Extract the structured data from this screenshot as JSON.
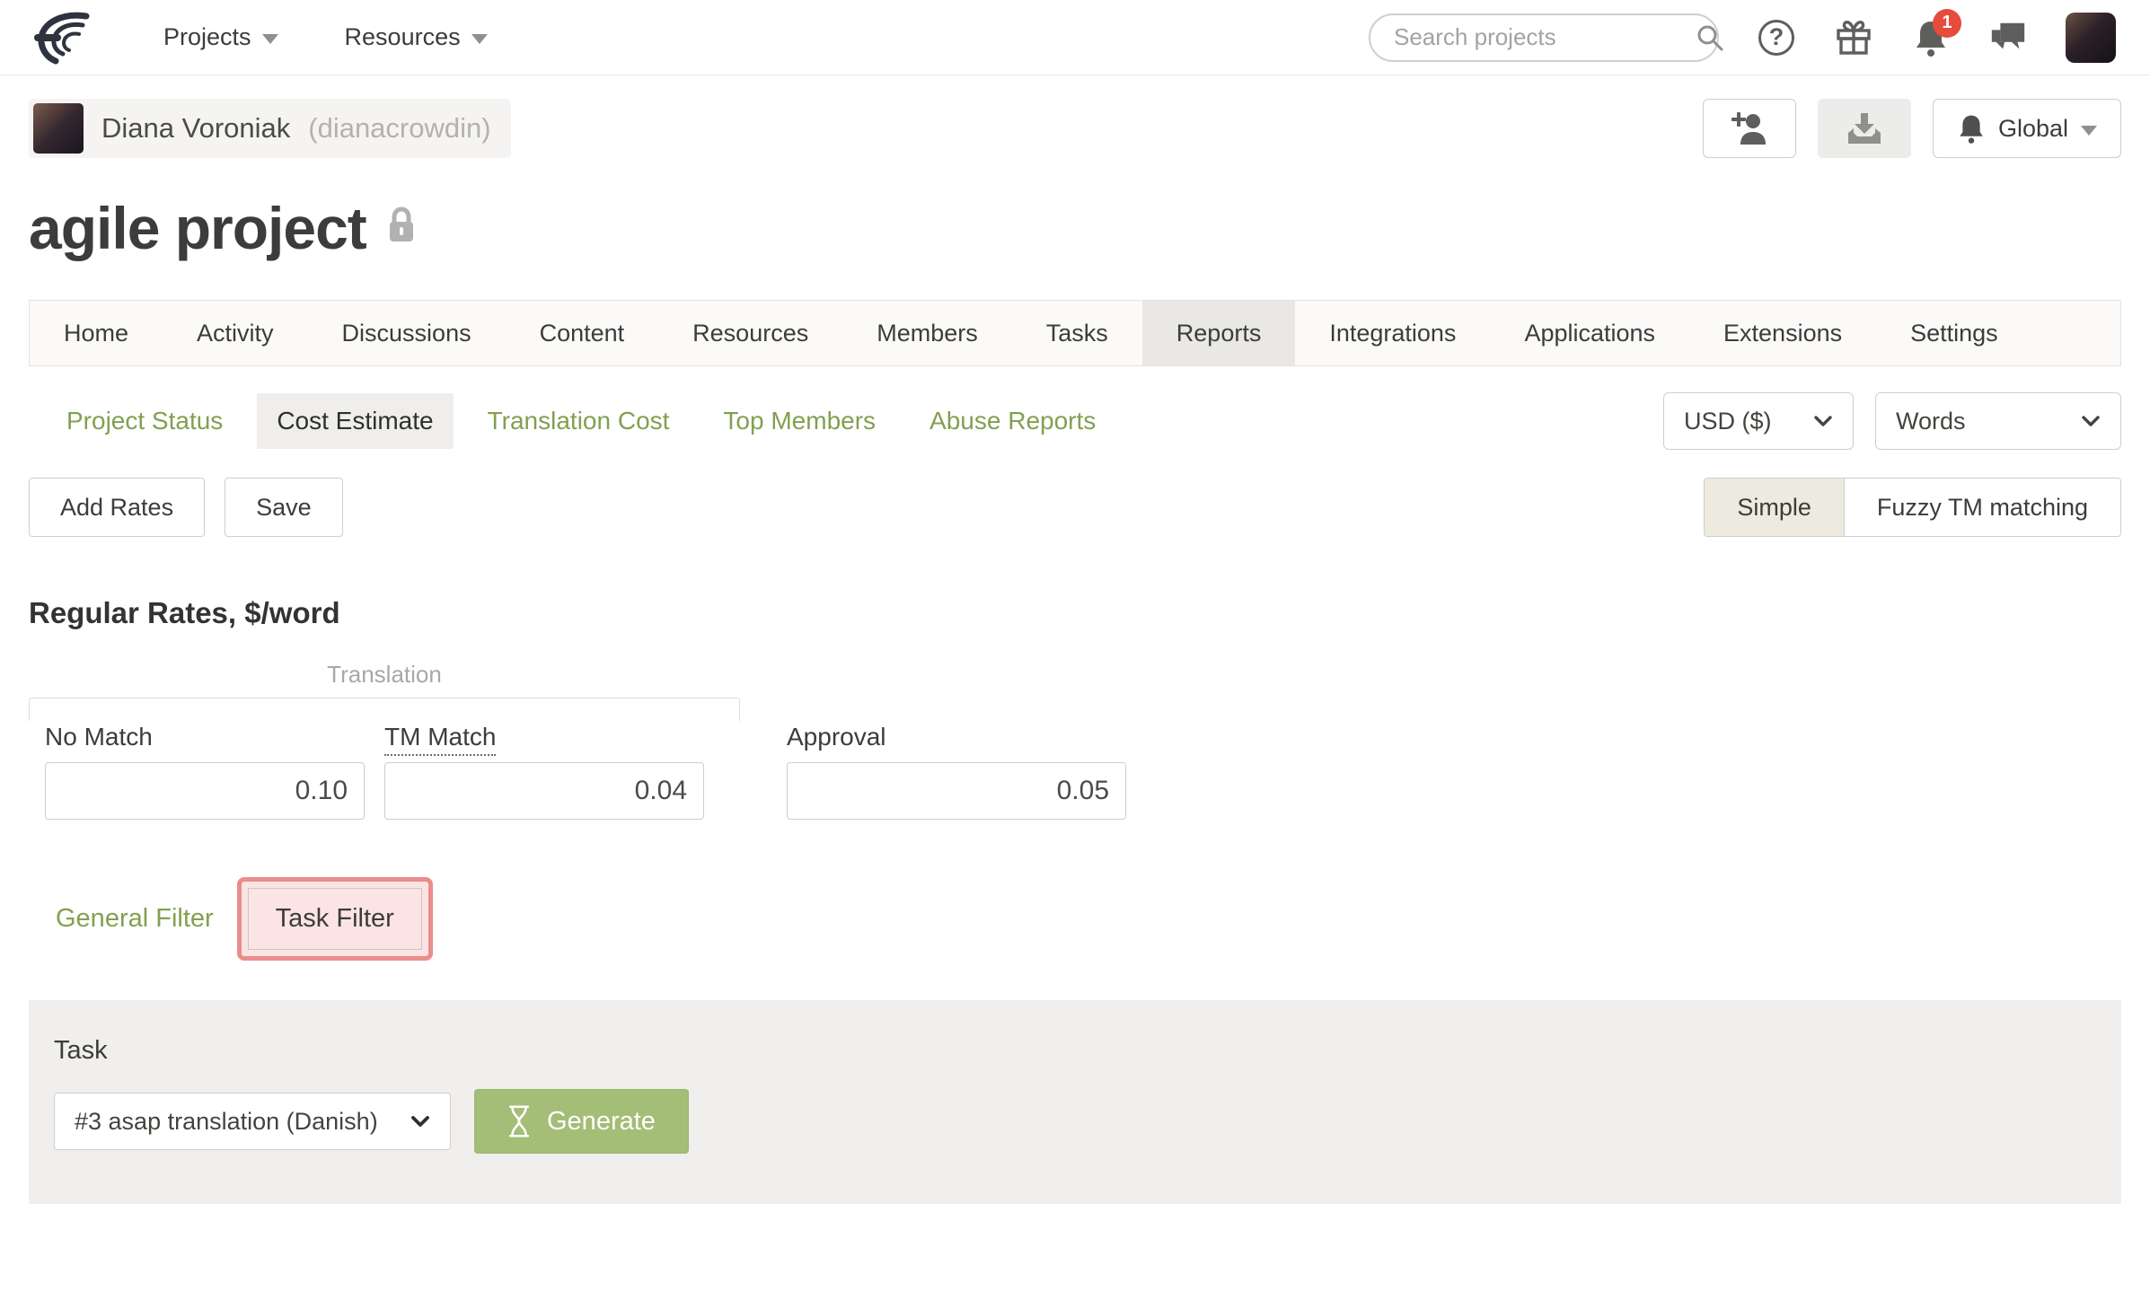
{
  "navbar": {
    "projects_label": "Projects",
    "resources_label": "Resources",
    "search_placeholder": "Search projects",
    "notification_count": "1"
  },
  "user_row": {
    "name": "Diana Voroniak",
    "username": "(dianacrowdin)",
    "global_label": "Global"
  },
  "page": {
    "title": "agile project"
  },
  "tabs": [
    "Home",
    "Activity",
    "Discussions",
    "Content",
    "Resources",
    "Members",
    "Tasks",
    "Reports",
    "Integrations",
    "Applications",
    "Extensions",
    "Settings"
  ],
  "active_tab": "Reports",
  "subtabs": [
    "Project Status",
    "Cost Estimate",
    "Translation Cost",
    "Top Members",
    "Abuse Reports"
  ],
  "active_subtab": "Cost Estimate",
  "controls": {
    "currency": "USD ($)",
    "unit": "Words"
  },
  "actions": {
    "add_rates_label": "Add Rates",
    "save_label": "Save",
    "simple_label": "Simple",
    "fuzzy_label": "Fuzzy TM matching"
  },
  "rates": {
    "heading": "Regular Rates, $/word",
    "group_label": "Translation",
    "columns": [
      {
        "label": "No Match",
        "value": "0.10"
      },
      {
        "label": "TM Match",
        "value": "0.04"
      },
      {
        "label": "Approval",
        "value": "0.05"
      }
    ]
  },
  "filters": {
    "general_label": "General Filter",
    "task_label": "Task Filter"
  },
  "task_panel": {
    "label": "Task",
    "selected_task": "#3 asap translation (Danish)",
    "generate_label": "Generate"
  },
  "colors": {
    "accent_green": "#82a051",
    "generate_green": "#a4bd77",
    "badge_red": "#e74b3c",
    "highlight_ring": "#ea8d8b",
    "highlight_fill": "#fbe4e3",
    "active_tab_bg": "#e9e8e4",
    "simple_active_bg": "#edebdf",
    "panel_bg": "#f0efed"
  }
}
